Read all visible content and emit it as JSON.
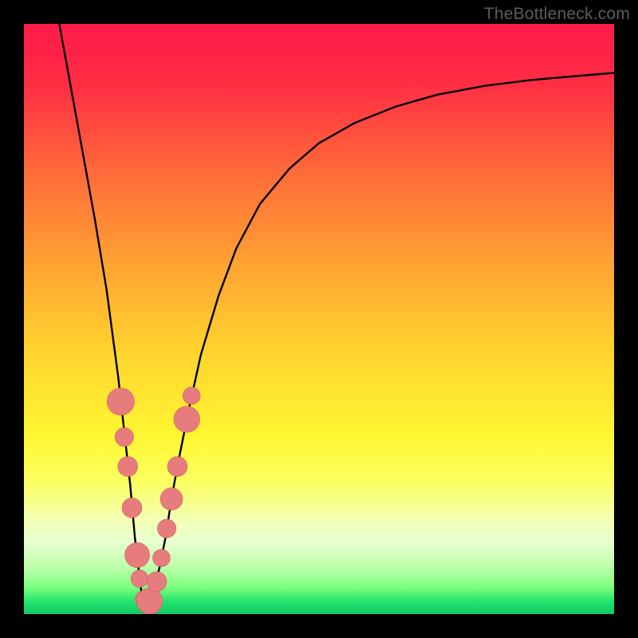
{
  "watermark": "TheBottleneck.com",
  "colors": {
    "frame": "#000000",
    "curve": "#000000",
    "marker_fill": "#e77c7e",
    "marker_stroke": "#d25c5e",
    "gradient_stops": [
      {
        "offset": 0.0,
        "color": "#ff1a4a"
      },
      {
        "offset": 0.1,
        "color": "#ff2d44"
      },
      {
        "offset": 0.25,
        "color": "#ff6a3a"
      },
      {
        "offset": 0.4,
        "color": "#ffa033"
      },
      {
        "offset": 0.55,
        "color": "#ffd22e"
      },
      {
        "offset": 0.7,
        "color": "#fff733"
      },
      {
        "offset": 0.78,
        "color": "#fbff64"
      },
      {
        "offset": 0.84,
        "color": "#f3ffb4"
      },
      {
        "offset": 0.88,
        "color": "#e6ffd0"
      },
      {
        "offset": 0.92,
        "color": "#beffab"
      },
      {
        "offset": 0.955,
        "color": "#7bff7d"
      },
      {
        "offset": 0.98,
        "color": "#1fe26c"
      },
      {
        "offset": 1.0,
        "color": "#14c966"
      }
    ]
  },
  "chart_data": {
    "type": "line",
    "title": "",
    "xlabel": "",
    "ylabel": "",
    "xlim": [
      0,
      100
    ],
    "ylim": [
      0,
      100
    ],
    "series": [
      {
        "name": "bottleneck-curve",
        "x": [
          6.0,
          8.0,
          10.0,
          12.0,
          14.0,
          16.0,
          17.0,
          18.0,
          18.8,
          19.5,
          20.0,
          21.0,
          22.0,
          23.0,
          24.0,
          25.0,
          26.0,
          28.0,
          30.0,
          33.0,
          36.0,
          40.0,
          45.0,
          50.0,
          56.0,
          63.0,
          70.0,
          78.0,
          86.0,
          94.0,
          100.0
        ],
        "y": [
          100.0,
          89.0,
          78.0,
          67.0,
          55.0,
          40.0,
          31.0,
          22.0,
          13.0,
          7.0,
          3.0,
          2.0,
          4.0,
          8.0,
          13.0,
          19.5,
          25.0,
          35.0,
          44.0,
          54.0,
          62.0,
          69.5,
          75.5,
          79.8,
          83.2,
          86.0,
          88.0,
          89.5,
          90.5,
          91.2,
          91.7
        ]
      }
    ],
    "markers": {
      "name": "highlighted-points",
      "points": [
        {
          "x": 16.4,
          "y": 36.0,
          "r": 2.2
        },
        {
          "x": 17.0,
          "y": 30.0,
          "r": 1.5
        },
        {
          "x": 17.6,
          "y": 25.0,
          "r": 1.6
        },
        {
          "x": 18.3,
          "y": 18.0,
          "r": 1.6
        },
        {
          "x": 19.2,
          "y": 10.0,
          "r": 2.0
        },
        {
          "x": 19.6,
          "y": 6.0,
          "r": 1.4
        },
        {
          "x": 20.3,
          "y": 2.5,
          "r": 1.4
        },
        {
          "x": 21.3,
          "y": 2.2,
          "r": 2.1
        },
        {
          "x": 22.5,
          "y": 5.5,
          "r": 1.6
        },
        {
          "x": 23.3,
          "y": 9.5,
          "r": 1.4
        },
        {
          "x": 24.2,
          "y": 14.5,
          "r": 1.5
        },
        {
          "x": 25.0,
          "y": 19.5,
          "r": 1.8
        },
        {
          "x": 26.0,
          "y": 25.0,
          "r": 1.6
        },
        {
          "x": 27.6,
          "y": 33.0,
          "r": 2.1
        },
        {
          "x": 28.4,
          "y": 37.0,
          "r": 1.4
        }
      ]
    }
  }
}
